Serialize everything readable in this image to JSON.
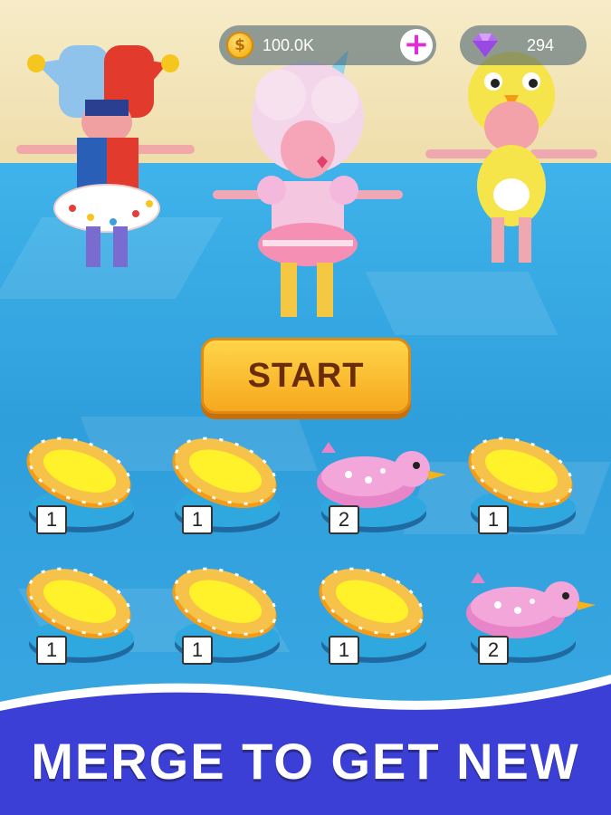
{
  "hud": {
    "coins": "100.0K",
    "coin_symbol": "$",
    "add_symbol": "+",
    "gems": "294"
  },
  "start_button": {
    "label": "START"
  },
  "slots": [
    {
      "item": "inflatable-raft",
      "level": "1"
    },
    {
      "item": "inflatable-raft",
      "level": "1"
    },
    {
      "item": "duck-float",
      "level": "2"
    },
    {
      "item": "inflatable-raft",
      "level": "1"
    },
    {
      "item": "inflatable-raft",
      "level": "1"
    },
    {
      "item": "inflatable-raft",
      "level": "1"
    },
    {
      "item": "inflatable-raft",
      "level": "1"
    },
    {
      "item": "duck-float",
      "level": "2"
    }
  ],
  "banner": {
    "text": "MERGE TO GET NEW"
  },
  "colors": {
    "water": "#2f9fdc",
    "sand": "#f6ecc8",
    "start_button": "#f6a81d",
    "banner": "#3b3fd6",
    "plus": "#e02bd6"
  }
}
